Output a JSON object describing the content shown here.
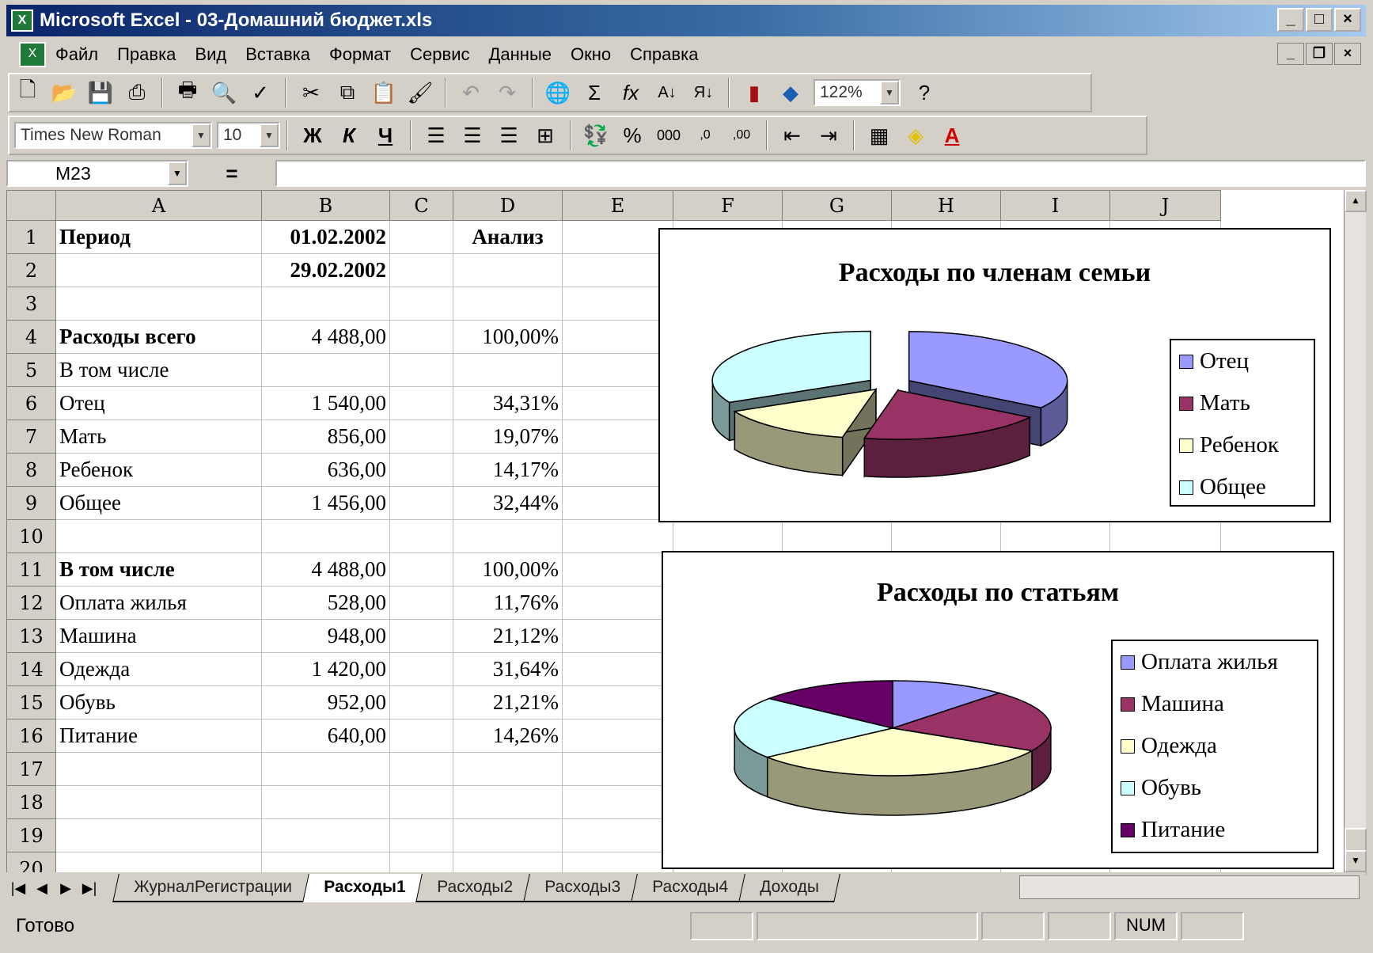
{
  "window": {
    "title": "Microsoft Excel - 03-Домашний бюджет.xls"
  },
  "menu": [
    "Файл",
    "Правка",
    "Вид",
    "Вставка",
    "Формат",
    "Сервис",
    "Данные",
    "Окно",
    "Справка"
  ],
  "toolbar": {
    "zoom": "122%",
    "font": "Times New Roman",
    "font_size": "10"
  },
  "formula_bar": {
    "cell": "M23",
    "equals": "="
  },
  "columns": [
    "A",
    "B",
    "C",
    "D",
    "E",
    "F",
    "G",
    "H",
    "I",
    "J"
  ],
  "rows": [
    {
      "n": "1",
      "a": "Период",
      "b": "01.02.2002",
      "d": "Анализ"
    },
    {
      "n": "2",
      "a": "",
      "b": "29.02.2002",
      "d": ""
    },
    {
      "n": "3",
      "a": "",
      "b": "",
      "d": ""
    },
    {
      "n": "4",
      "a": "Расходы всего",
      "b": "4 488,00",
      "d": "100,00%"
    },
    {
      "n": "5",
      "a": "В том числе",
      "b": "",
      "d": ""
    },
    {
      "n": "6",
      "a": "Отец",
      "b": "1 540,00",
      "d": "34,31%"
    },
    {
      "n": "7",
      "a": "Мать",
      "b": "856,00",
      "d": "19,07%"
    },
    {
      "n": "8",
      "a": "Ребенок",
      "b": "636,00",
      "d": "14,17%"
    },
    {
      "n": "9",
      "a": "Общее",
      "b": "1 456,00",
      "d": "32,44%"
    },
    {
      "n": "10",
      "a": "",
      "b": "",
      "d": ""
    },
    {
      "n": "11",
      "a": "В том числе",
      "b": "4 488,00",
      "d": "100,00%"
    },
    {
      "n": "12",
      "a": "Оплата жилья",
      "b": "528,00",
      "d": "11,76%"
    },
    {
      "n": "13",
      "a": "Машина",
      "b": "948,00",
      "d": "21,12%"
    },
    {
      "n": "14",
      "a": "Одежда",
      "b": "1 420,00",
      "d": "31,64%"
    },
    {
      "n": "15",
      "a": "Обувь",
      "b": "952,00",
      "d": "21,21%"
    },
    {
      "n": "16",
      "a": "Питание",
      "b": "640,00",
      "d": "14,26%"
    },
    {
      "n": "17",
      "a": "",
      "b": "",
      "d": ""
    },
    {
      "n": "18",
      "a": "",
      "b": "",
      "d": ""
    },
    {
      "n": "19",
      "a": "",
      "b": "",
      "d": ""
    },
    {
      "n": "20",
      "a": "",
      "b": "",
      "d": ""
    }
  ],
  "chart_data": [
    {
      "type": "pie",
      "title": "Расходы по членам семьи",
      "categories": [
        "Отец",
        "Мать",
        "Ребенок",
        "Общее"
      ],
      "values": [
        1540,
        856,
        636,
        1456
      ],
      "colors": [
        "#9999ff",
        "#993366",
        "#ffffcc",
        "#ccffff"
      ],
      "legend": "right"
    },
    {
      "type": "pie",
      "title": "Расходы по статьям",
      "categories": [
        "Оплата жилья",
        "Машина",
        "Одежда",
        "Обувь",
        "Питание"
      ],
      "values": [
        528,
        948,
        1420,
        952,
        640
      ],
      "colors": [
        "#9999ff",
        "#993366",
        "#ffffcc",
        "#ccffff",
        "#660066"
      ],
      "legend": "right"
    }
  ],
  "sheet_tabs": [
    "ЖурналРегистрации",
    "Расходы1",
    "Расходы2",
    "Расходы3",
    "Расходы4",
    "Доходы"
  ],
  "active_tab": "Расходы1",
  "status": {
    "text": "Готово",
    "num": "NUM"
  }
}
